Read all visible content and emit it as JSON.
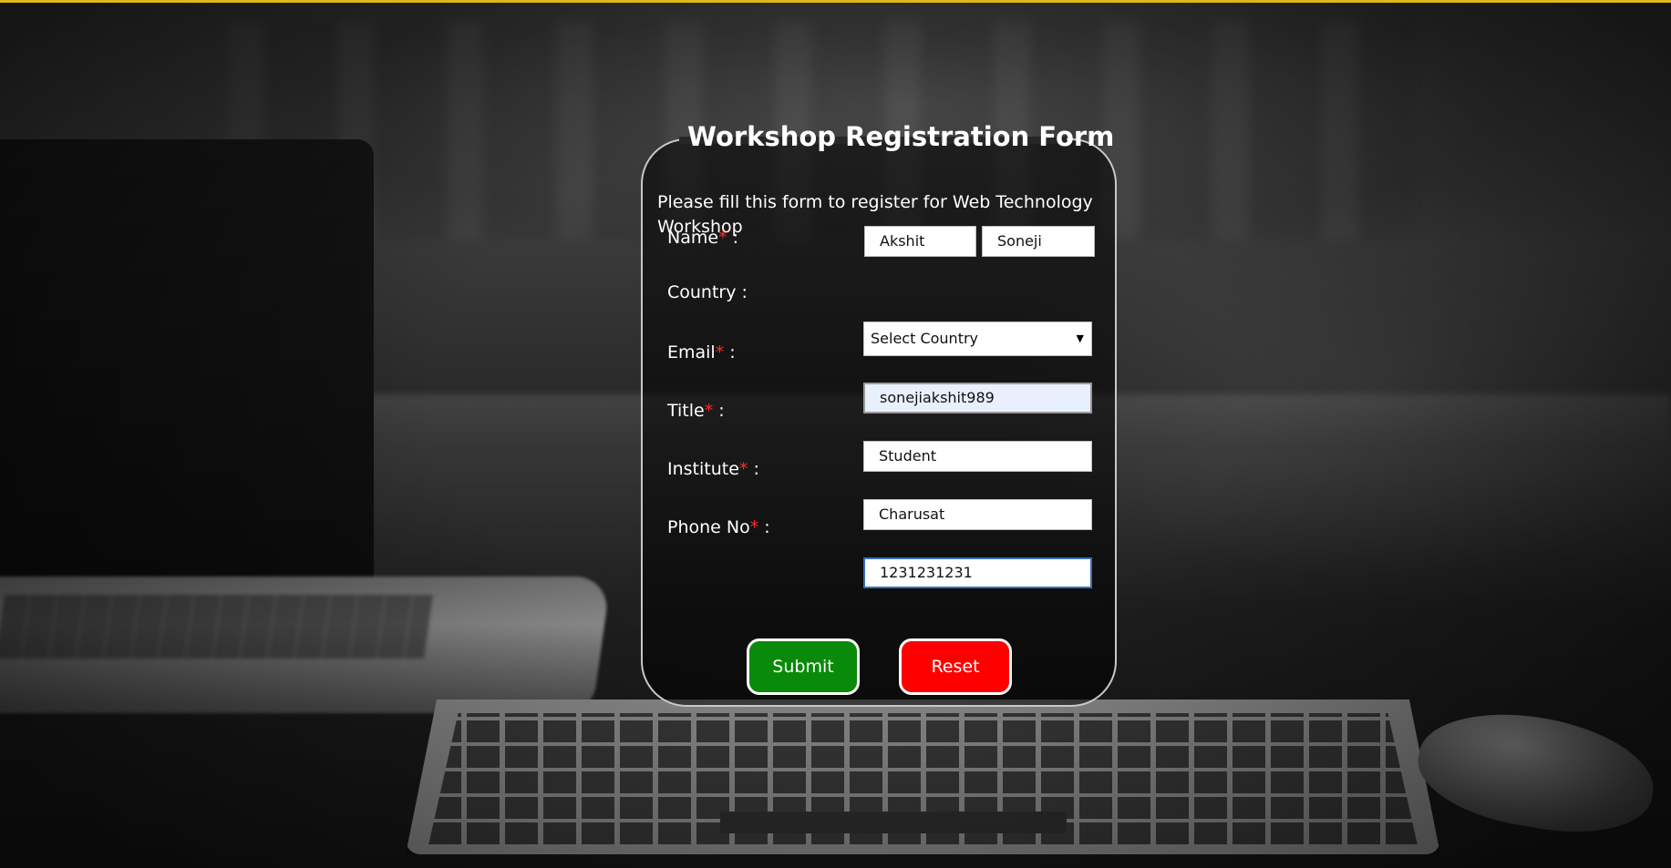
{
  "form": {
    "title": "Workshop Registration Form",
    "intro": "Please fill this form to register for Web Technology Workshop",
    "name_label": "Name",
    "first_name_value": "Akshit",
    "last_name_value": "Soneji",
    "country_label": "Country :",
    "country_selected": "Select Country",
    "email_label": "Email",
    "email_value": "sonejiakshit989",
    "title_label": "Title",
    "title_value": "Student",
    "institute_label": "Institute",
    "institute_value": "Charusat",
    "phone_label": "Phone No",
    "phone_value": "1231231231",
    "required_mark": "*",
    "colon": " :",
    "submit_label": "Submit",
    "reset_label": "Reset"
  },
  "colors": {
    "top_bar": "#e0b816",
    "required": "#ff2a2a",
    "submit_bg": "#0a8a0a",
    "reset_bg": "#ff0000",
    "email_autofill_bg": "#e8f0fe",
    "phone_focus_border": "#3b6fb6"
  },
  "icons": {
    "select_arrow": "triangle-down-icon"
  }
}
